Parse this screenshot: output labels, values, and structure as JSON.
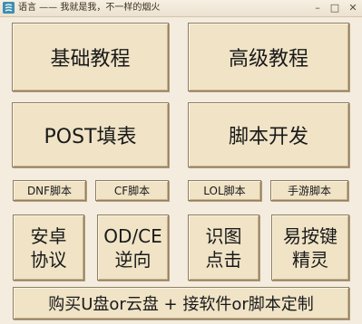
{
  "window": {
    "title": "语言 —— 我就是我，不一样的烟火",
    "minimize_glyph": "–",
    "maximize_glyph": "□",
    "close_glyph": "✕"
  },
  "buttons": {
    "basic_tutorial": "基础教程",
    "advanced_tutorial": "高级教程",
    "post_form": "POST填表",
    "script_dev": "脚本开发",
    "dnf_script": "DNF脚本",
    "cf_script": "CF脚本",
    "lol_script": "LOL脚本",
    "mobile_game_script": "手游脚本",
    "android_protocol": "安卓\n协议",
    "od_ce_reverse": "OD/CE\n逆向",
    "image_click": "识图\n点击",
    "easy_key_wizard": "易按键\n精灵",
    "purchase": "购买U盘or云盘 + 接软件or脚本定制"
  }
}
